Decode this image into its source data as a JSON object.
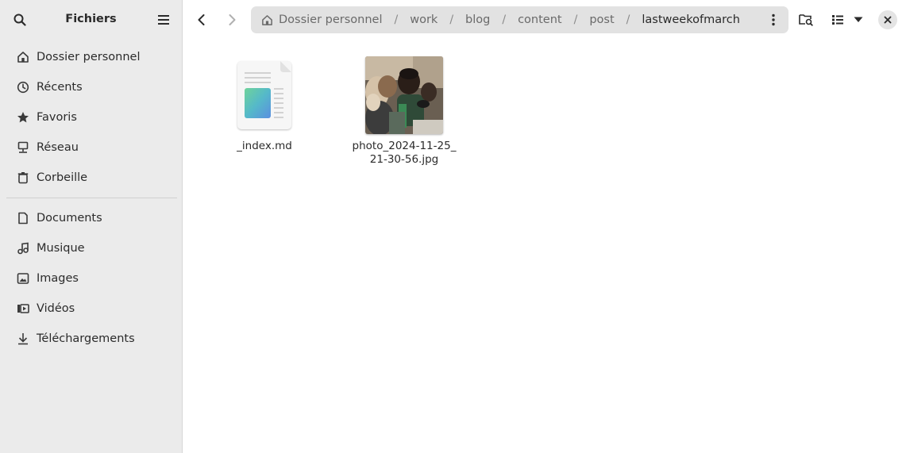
{
  "sidebar": {
    "title": "Fichiers",
    "places": [
      {
        "label": "Dossier personnel",
        "icon": "home-icon"
      },
      {
        "label": "Récents",
        "icon": "clock-icon"
      },
      {
        "label": "Favoris",
        "icon": "star-icon"
      },
      {
        "label": "Réseau",
        "icon": "network-icon"
      },
      {
        "label": "Corbeille",
        "icon": "trash-icon"
      }
    ],
    "bookmarks": [
      {
        "label": "Documents",
        "icon": "document-icon"
      },
      {
        "label": "Musique",
        "icon": "music-icon"
      },
      {
        "label": "Images",
        "icon": "image-icon"
      },
      {
        "label": "Vidéos",
        "icon": "video-icon"
      },
      {
        "label": "Téléchargements",
        "icon": "download-icon"
      }
    ]
  },
  "pathbar": {
    "crumbs": [
      "Dossier personnel",
      "work",
      "blog",
      "content",
      "post",
      "lastweekofmarch"
    ],
    "separator": "/"
  },
  "files": [
    {
      "name": "_index.md",
      "type": "markdown-document"
    },
    {
      "name_line1": "photo_2024-11-25_",
      "name_line2": "21-30-56.jpg",
      "type": "jpeg-photo"
    }
  ],
  "colors": {
    "sidebar_bg": "#ebebeb",
    "pathbar_bg": "#e2e2e2",
    "main_bg": "#ffffff"
  }
}
